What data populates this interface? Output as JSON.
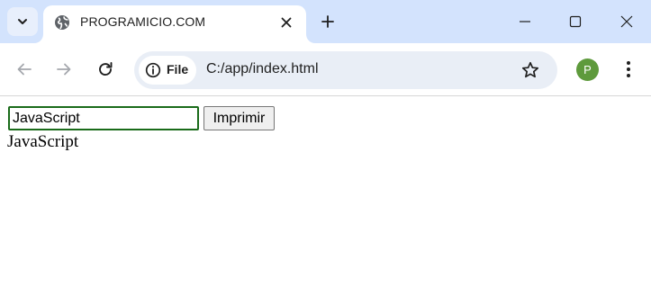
{
  "browser": {
    "tab": {
      "title": "PROGRAMICIO.COM",
      "favicon": "globe-icon"
    },
    "window_controls": [
      "minimize-icon",
      "maximize-icon",
      "close-icon"
    ],
    "address_bar": {
      "site_chip_label": "File",
      "url": "C:/app/index.html"
    },
    "profile_initial": "P",
    "colors": {
      "tabstrip": "#d3e3fd",
      "omnibox": "#e9eef6",
      "avatar": "#5e9a3c"
    }
  },
  "page": {
    "input_value": "JavaScript",
    "button_label": "Imprimir",
    "output_text": "JavaScript",
    "input_border_color": "#1a6b1a"
  }
}
